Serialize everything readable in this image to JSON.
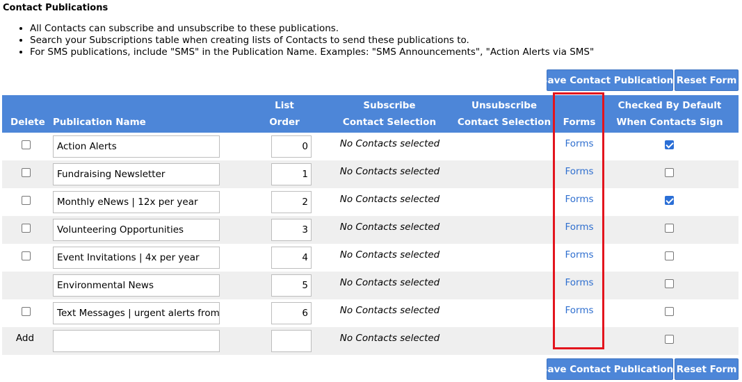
{
  "page": {
    "title": "Contact Publications",
    "bullets": [
      "All Contacts can subscribe and unsubscribe to these publications.",
      "Search your Subscriptions table when creating lists of Contacts to send these publications to.",
      "For SMS publications, include \"SMS\" in the Publication Name. Examples: \"SMS Announcements\", \"Action Alerts via SMS\""
    ]
  },
  "buttons": {
    "save_label": "Save Contact Publications",
    "reset_label": "Reset Form"
  },
  "table": {
    "headers": {
      "delete": "Delete",
      "publication_name": "Publication Name",
      "list_order_1": "List",
      "list_order_2": "Order",
      "subscribe_1": "Subscribe",
      "subscribe_2": "Contact Selection",
      "unsubscribe_1": "Unsubscribe",
      "unsubscribe_2": "Contact Selection",
      "forms": "Forms",
      "checked_1": "Checked By Default",
      "checked_2": "When Contacts Sign Up"
    },
    "rows": [
      {
        "has_delete": true,
        "delete_checked": false,
        "name": "Action Alerts",
        "order": "0",
        "subscribe": "No Contacts selected",
        "forms": "Forms",
        "default_checked": true
      },
      {
        "has_delete": true,
        "delete_checked": false,
        "name": "Fundraising Newsletter",
        "order": "1",
        "subscribe": "No Contacts selected",
        "forms": "Forms",
        "default_checked": false
      },
      {
        "has_delete": true,
        "delete_checked": false,
        "name": "Monthly eNews | 12x per year",
        "order": "2",
        "subscribe": "No Contacts selected",
        "forms": "Forms",
        "default_checked": true
      },
      {
        "has_delete": true,
        "delete_checked": false,
        "name": "Volunteering Opportunities",
        "order": "3",
        "subscribe": "No Contacts selected",
        "forms": "Forms",
        "default_checked": false
      },
      {
        "has_delete": true,
        "delete_checked": false,
        "name": "Event Invitations | 4x per year",
        "order": "4",
        "subscribe": "No Contacts selected",
        "forms": "Forms",
        "default_checked": false
      },
      {
        "has_delete": false,
        "delete_checked": false,
        "name": "Environmental News",
        "order": "5",
        "subscribe": "No Contacts selected",
        "forms": "Forms",
        "default_checked": false
      },
      {
        "has_delete": true,
        "delete_checked": false,
        "name": "Text Messages | urgent alerts from Ou",
        "order": "6",
        "subscribe": "No Contacts selected",
        "forms": "Forms",
        "default_checked": false
      }
    ],
    "add_row": {
      "label": "Add",
      "name": "",
      "order": "",
      "subscribe": "No Contacts selected",
      "default_checked": false
    }
  },
  "colors": {
    "header_bg": "#4d86d8",
    "button_bg": "#4d86d8",
    "link": "#2f6fcf",
    "highlight": "#e3141d",
    "checkbox_checked": "#2b6fd6"
  }
}
